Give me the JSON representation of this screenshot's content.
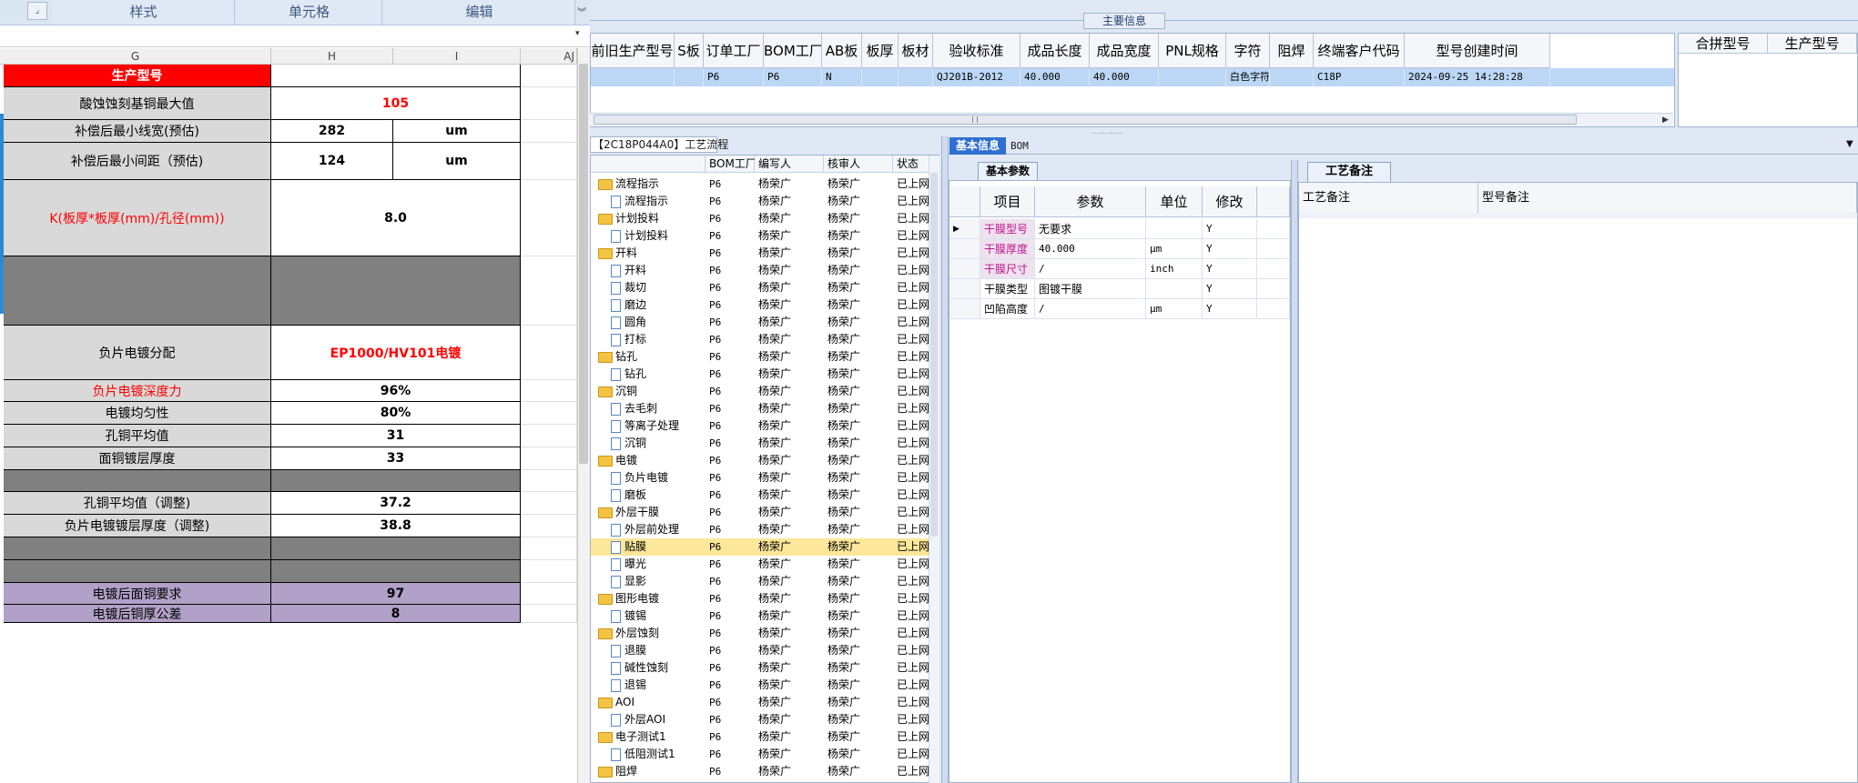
{
  "excel": {
    "ribbon": [
      "样式",
      "单元格",
      "编辑"
    ],
    "columns": [
      "G",
      "H",
      "I",
      "AJ"
    ],
    "rows": [
      {
        "label": "生产型号",
        "value": "",
        "unit": ""
      },
      {
        "label": "酸蚀蚀刻基铜最大值",
        "value": "105",
        "unit": ""
      },
      {
        "label": "补偿后最小线宽(预估)",
        "value": "282",
        "unit": "um"
      },
      {
        "label": "补偿后最小间距（预估)",
        "value": "124",
        "unit": "um"
      },
      {
        "label": "K(板厚*板厚(mm)/孔径(mm))",
        "value": "8.0",
        "unit": ""
      },
      {
        "label": "",
        "value": "",
        "unit": ""
      },
      {
        "label": "负片电镀分配",
        "value": "EP1000/HV101电镀",
        "unit": ""
      },
      {
        "label": "负片电镀深度力",
        "value": "96%",
        "unit": ""
      },
      {
        "label": "电镀均匀性",
        "value": "80%",
        "unit": ""
      },
      {
        "label": "孔铜平均值",
        "value": "31",
        "unit": ""
      },
      {
        "label": "面铜镀层厚度",
        "value": "33",
        "unit": ""
      },
      {
        "label": "",
        "value": "",
        "unit": ""
      },
      {
        "label": "孔铜平均值（调整)",
        "value": "37.2",
        "unit": ""
      },
      {
        "label": "负片电镀镀层厚度（调整)",
        "value": "38.8",
        "unit": ""
      },
      {
        "label": "",
        "value": "",
        "unit": ""
      },
      {
        "label": "",
        "value": "",
        "unit": ""
      },
      {
        "label": "电镀后面铜要求",
        "value": "97",
        "unit": ""
      },
      {
        "label": "电镀后铜厚公差",
        "value": "8",
        "unit": ""
      }
    ]
  },
  "main_info": {
    "title": "主要信息",
    "headers": [
      "前旧生产型号",
      "S板",
      "订单工厂",
      "BOM工厂",
      "AB板",
      "板厚",
      "板材",
      "验收标准",
      "成品长度",
      "成品宽度",
      "PNL规格",
      "字符",
      "阻焊",
      "终端客户代码",
      "型号创建时间"
    ],
    "row": [
      "",
      "",
      "P6",
      "P6",
      "N",
      "",
      "",
      "QJ201B-2012",
      "40.000",
      "40.000",
      "",
      "白色字符",
      "",
      "C18P",
      "2024-09-25 14:28:28"
    ],
    "merge_headers": [
      "合拼型号",
      "生产型号"
    ]
  },
  "process": {
    "title": "【2C18P044A0】工艺流程",
    "headers": [
      "",
      "BOM工厂",
      "编写人",
      "核审人",
      "状态"
    ],
    "rows": [
      {
        "level": 0,
        "name": "流程指示",
        "factory": "P6",
        "writer": "杨荣广",
        "reviewer": "杨荣广",
        "status": "已上网"
      },
      {
        "level": 1,
        "name": "流程指示",
        "factory": "P6",
        "writer": "杨荣广",
        "reviewer": "杨荣广",
        "status": "已上网"
      },
      {
        "level": 0,
        "name": "计划投料",
        "factory": "P6",
        "writer": "杨荣广",
        "reviewer": "杨荣广",
        "status": "已上网"
      },
      {
        "level": 1,
        "name": "计划投料",
        "factory": "P6",
        "writer": "杨荣广",
        "reviewer": "杨荣广",
        "status": "已上网"
      },
      {
        "level": 0,
        "name": "开料",
        "factory": "P6",
        "writer": "杨荣广",
        "reviewer": "杨荣广",
        "status": "已上网"
      },
      {
        "level": 1,
        "name": "开料",
        "factory": "P6",
        "writer": "杨荣广",
        "reviewer": "杨荣广",
        "status": "已上网"
      },
      {
        "level": 1,
        "name": "裁切",
        "factory": "P6",
        "writer": "杨荣广",
        "reviewer": "杨荣广",
        "status": "已上网"
      },
      {
        "level": 1,
        "name": "磨边",
        "factory": "P6",
        "writer": "杨荣广",
        "reviewer": "杨荣广",
        "status": "已上网"
      },
      {
        "level": 1,
        "name": "圆角",
        "factory": "P6",
        "writer": "杨荣广",
        "reviewer": "杨荣广",
        "status": "已上网"
      },
      {
        "level": 1,
        "name": "打标",
        "factory": "P6",
        "writer": "杨荣广",
        "reviewer": "杨荣广",
        "status": "已上网"
      },
      {
        "level": 0,
        "name": "钻孔",
        "factory": "P6",
        "writer": "杨荣广",
        "reviewer": "杨荣广",
        "status": "已上网"
      },
      {
        "level": 1,
        "name": "钻孔",
        "factory": "P6",
        "writer": "杨荣广",
        "reviewer": "杨荣广",
        "status": "已上网"
      },
      {
        "level": 0,
        "name": "沉铜",
        "factory": "P6",
        "writer": "杨荣广",
        "reviewer": "杨荣广",
        "status": "已上网"
      },
      {
        "level": 1,
        "name": "去毛刺",
        "factory": "P6",
        "writer": "杨荣广",
        "reviewer": "杨荣广",
        "status": "已上网"
      },
      {
        "level": 1,
        "name": "等离子处理",
        "factory": "P6",
        "writer": "杨荣广",
        "reviewer": "杨荣广",
        "status": "已上网"
      },
      {
        "level": 1,
        "name": "沉铜",
        "factory": "P6",
        "writer": "杨荣广",
        "reviewer": "杨荣广",
        "status": "已上网"
      },
      {
        "level": 0,
        "name": "电镀",
        "factory": "P6",
        "writer": "杨荣广",
        "reviewer": "杨荣广",
        "status": "已上网"
      },
      {
        "level": 1,
        "name": "负片电镀",
        "factory": "P6",
        "writer": "杨荣广",
        "reviewer": "杨荣广",
        "status": "已上网"
      },
      {
        "level": 1,
        "name": "磨板",
        "factory": "P6",
        "writer": "杨荣广",
        "reviewer": "杨荣广",
        "status": "已上网"
      },
      {
        "level": 0,
        "name": "外层干膜",
        "factory": "P6",
        "writer": "杨荣广",
        "reviewer": "杨荣广",
        "status": "已上网"
      },
      {
        "level": 1,
        "name": "外层前处理",
        "factory": "P6",
        "writer": "杨荣广",
        "reviewer": "杨荣广",
        "status": "已上网"
      },
      {
        "level": 1,
        "name": "贴膜",
        "factory": "P6",
        "writer": "杨荣广",
        "reviewer": "杨荣广",
        "status": "已上网",
        "selected": true
      },
      {
        "level": 1,
        "name": "曝光",
        "factory": "P6",
        "writer": "杨荣广",
        "reviewer": "杨荣广",
        "status": "已上网"
      },
      {
        "level": 1,
        "name": "显影",
        "factory": "P6",
        "writer": "杨荣广",
        "reviewer": "杨荣广",
        "status": "已上网"
      },
      {
        "level": 0,
        "name": "图形电镀",
        "factory": "P6",
        "writer": "杨荣广",
        "reviewer": "杨荣广",
        "status": "已上网"
      },
      {
        "level": 1,
        "name": "镀锡",
        "factory": "P6",
        "writer": "杨荣广",
        "reviewer": "杨荣广",
        "status": "已上网"
      },
      {
        "level": 0,
        "name": "外层蚀刻",
        "factory": "P6",
        "writer": "杨荣广",
        "reviewer": "杨荣广",
        "status": "已上网"
      },
      {
        "level": 1,
        "name": "退膜",
        "factory": "P6",
        "writer": "杨荣广",
        "reviewer": "杨荣广",
        "status": "已上网"
      },
      {
        "level": 1,
        "name": "碱性蚀刻",
        "factory": "P6",
        "writer": "杨荣广",
        "reviewer": "杨荣广",
        "status": "已上网"
      },
      {
        "level": 1,
        "name": "退锡",
        "factory": "P6",
        "writer": "杨荣广",
        "reviewer": "杨荣广",
        "status": "已上网"
      },
      {
        "level": 0,
        "name": "AOI",
        "factory": "P6",
        "writer": "杨荣广",
        "reviewer": "杨荣广",
        "status": "已上网"
      },
      {
        "level": 1,
        "name": "外层AOI",
        "factory": "P6",
        "writer": "杨荣广",
        "reviewer": "杨荣广",
        "status": "已上网"
      },
      {
        "level": 0,
        "name": "电子测试1",
        "factory": "P6",
        "writer": "杨荣广",
        "reviewer": "杨荣广",
        "status": "已上网"
      },
      {
        "level": 1,
        "name": "低阻测试1",
        "factory": "P6",
        "writer": "杨荣广",
        "reviewer": "杨荣广",
        "status": "已上网"
      },
      {
        "level": 0,
        "name": "阻焊",
        "factory": "P6",
        "writer": "杨荣广",
        "reviewer": "杨荣广",
        "status": "已上网"
      }
    ]
  },
  "basic": {
    "tabs": [
      "基本信息",
      "BOM"
    ],
    "subtab": "基本参数",
    "headers": [
      "项目",
      "参数",
      "单位",
      "修改"
    ],
    "rows": [
      {
        "item": "干膜型号",
        "param": "无要求",
        "unit": "",
        "mod": "Y",
        "highlight": true
      },
      {
        "item": "干膜厚度",
        "param": "40.000",
        "unit": "μm",
        "mod": "Y",
        "highlight": true
      },
      {
        "item": "干膜尺寸",
        "param": "/",
        "unit": "inch",
        "mod": "Y",
        "highlight": true
      },
      {
        "item": "干膜类型",
        "param": "图镀干膜",
        "unit": "",
        "mod": "Y",
        "highlight": false
      },
      {
        "item": "凹陷高度",
        "param": "/",
        "unit": "μm",
        "mod": "Y",
        "highlight": false
      }
    ]
  },
  "remarks": {
    "tab": "工艺备注",
    "headers": [
      "工艺备注",
      "型号备注"
    ]
  }
}
